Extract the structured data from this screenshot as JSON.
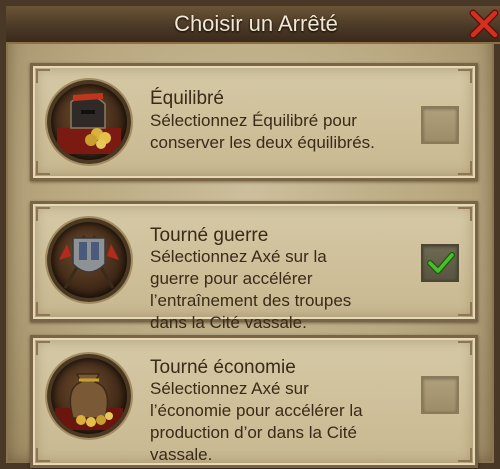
{
  "dialog": {
    "title": "Choisir un Arrêté"
  },
  "options": [
    {
      "title": "Équilibré",
      "desc_lines": [
        "Sélectionnez Équilibré pour",
        "conserver les deux équilibrés."
      ],
      "checked": false,
      "icon": "helmet-gold-icon"
    },
    {
      "title": "Tourné guerre",
      "desc_lines": [
        "Sélectionnez Axé sur la",
        "guerre pour accélérer",
        "l’entraînement des troupes",
        "dans la Cité vassale."
      ],
      "checked": true,
      "icon": "crossed-flags-shield-icon"
    },
    {
      "title": "Tourné économie",
      "desc_lines": [
        "Sélectionnez Axé sur",
        "l’économie pour accélérer la",
        "production d’or dans la Cité",
        "vassale."
      ],
      "checked": false,
      "icon": "gold-sack-icon"
    }
  ],
  "colors": {
    "check": "#49c02a",
    "close": "#c8281c"
  }
}
